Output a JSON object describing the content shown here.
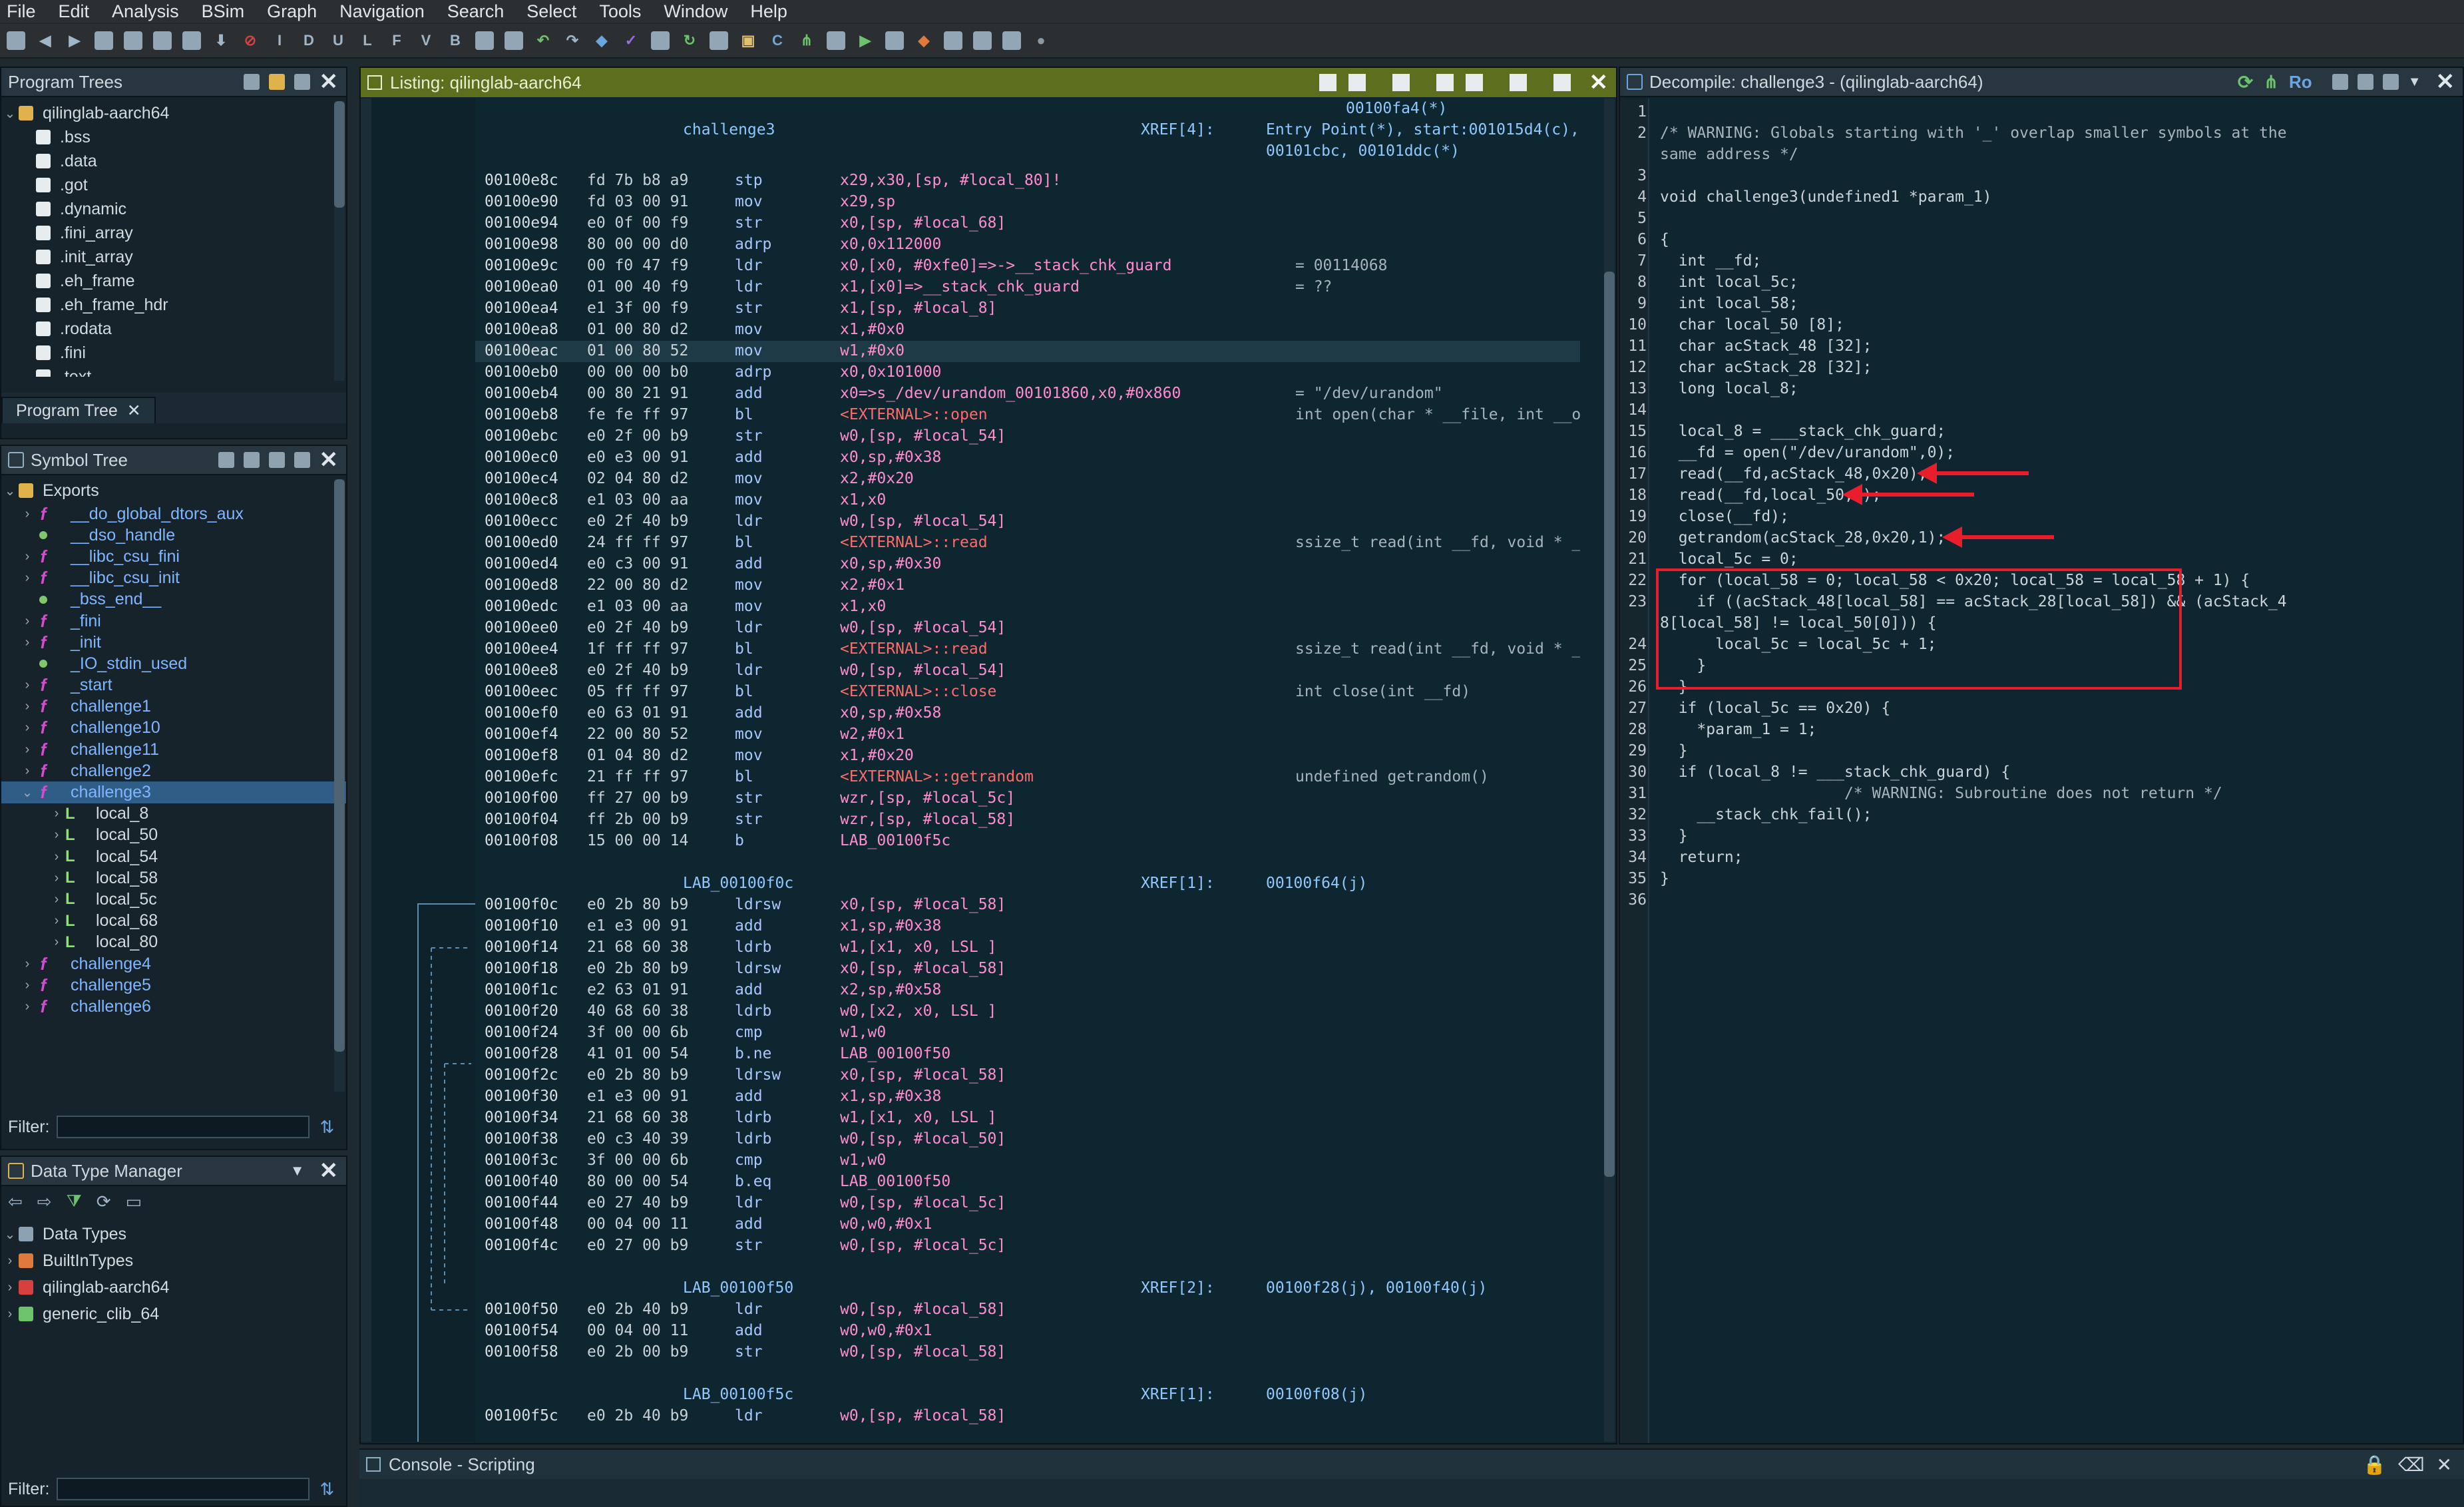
{
  "menu": [
    "File",
    "Edit",
    "Analysis",
    "BSim",
    "Graph",
    "Navigation",
    "Search",
    "Select",
    "Tools",
    "Window",
    "Help"
  ],
  "program_trees": {
    "title": "Program Trees",
    "root": "qilinglab-aarch64",
    "sections": [
      ".bss",
      ".data",
      ".got",
      ".dynamic",
      ".fini_array",
      ".init_array",
      ".eh_frame",
      ".eh_frame_hdr",
      ".rodata",
      ".fini",
      ".text"
    ],
    "tab": "Program Tree"
  },
  "symbol_tree": {
    "title": "Symbol Tree",
    "exports_label": "Exports",
    "items": [
      {
        "name": "__do_global_dtors_aux",
        "kind": "f"
      },
      {
        "name": "__dso_handle",
        "kind": "d"
      },
      {
        "name": "__libc_csu_fini",
        "kind": "f"
      },
      {
        "name": "__libc_csu_init",
        "kind": "f"
      },
      {
        "name": "_bss_end__",
        "kind": "d"
      },
      {
        "name": "_fini",
        "kind": "f"
      },
      {
        "name": "_init",
        "kind": "f"
      },
      {
        "name": "_IO_stdin_used",
        "kind": "d"
      },
      {
        "name": "_start",
        "kind": "f"
      },
      {
        "name": "challenge1",
        "kind": "f"
      },
      {
        "name": "challenge10",
        "kind": "f"
      },
      {
        "name": "challenge11",
        "kind": "f"
      },
      {
        "name": "challenge2",
        "kind": "f"
      },
      {
        "name": "challenge3",
        "kind": "f",
        "selected": true
      },
      {
        "name": "local_8",
        "kind": "l"
      },
      {
        "name": "local_50",
        "kind": "l"
      },
      {
        "name": "local_54",
        "kind": "l"
      },
      {
        "name": "local_58",
        "kind": "l"
      },
      {
        "name": "local_5c",
        "kind": "l"
      },
      {
        "name": "local_68",
        "kind": "l"
      },
      {
        "name": "local_80",
        "kind": "l"
      },
      {
        "name": "challenge4",
        "kind": "f"
      },
      {
        "name": "challenge5",
        "kind": "f"
      },
      {
        "name": "challenge6",
        "kind": "f"
      }
    ],
    "filter_label": "Filter:"
  },
  "data_type_manager": {
    "title": "Data Type Manager",
    "root": "Data Types",
    "items": [
      "BuiltInTypes",
      "qilinglab-aarch64",
      "generic_clib_64"
    ],
    "filter_label": "Filter:"
  },
  "listing": {
    "title": "Listing:  qilinglab-aarch64",
    "header": {
      "label": "challenge3",
      "xref": "XREF[4]:",
      "refs1": "00100fa4(*)",
      "refs2": "Entry Point(*), start:001015d4(c),",
      "refs3": "00101cbc, 00101ddc(*)"
    },
    "rows": [
      [
        "00100e8c",
        "fd 7b b8 a9",
        "stp",
        "x29,x30,[sp, #local_80]!",
        ""
      ],
      [
        "00100e90",
        "fd 03 00 91",
        "mov",
        "x29,sp",
        ""
      ],
      [
        "00100e94",
        "e0 0f 00 f9",
        "str",
        "x0,[sp, #local_68]",
        ""
      ],
      [
        "00100e98",
        "80 00 00 d0",
        "adrp",
        "x0,0x112000",
        ""
      ],
      [
        "00100e9c",
        "00 f0 47 f9",
        "ldr",
        "x0,[x0, #0xfe0]=>->__stack_chk_guard",
        "= 00114068"
      ],
      [
        "00100ea0",
        "01 00 40 f9",
        "ldr",
        "x1,[x0]=>__stack_chk_guard",
        "= ??"
      ],
      [
        "00100ea4",
        "e1 3f 00 f9",
        "str",
        "x1,[sp, #local_8]",
        ""
      ],
      [
        "00100ea8",
        "01 00 80 d2",
        "mov",
        "x1,#0x0",
        ""
      ],
      [
        "00100eac",
        "01 00 80 52",
        "mov",
        "w1,#0x0",
        ""
      ],
      [
        "00100eb0",
        "00 00 00 b0",
        "adrp",
        "x0,0x101000",
        ""
      ],
      [
        "00100eb4",
        "00 80 21 91",
        "add",
        "x0=>s_/dev/urandom_00101860,x0,#0x860",
        "= \"/dev/urandom\""
      ],
      [
        "00100eb8",
        "fe fe ff 97",
        "bl",
        "<EXTERNAL>::open",
        "int open(char * __file, int __oflag, ...)"
      ],
      [
        "00100ebc",
        "e0 2f 00 b9",
        "str",
        "w0,[sp, #local_54]",
        ""
      ],
      [
        "00100ec0",
        "e0 e3 00 91",
        "add",
        "x0,sp,#0x38",
        ""
      ],
      [
        "00100ec4",
        "02 04 80 d2",
        "mov",
        "x2,#0x20",
        ""
      ],
      [
        "00100ec8",
        "e1 03 00 aa",
        "mov",
        "x1,x0",
        ""
      ],
      [
        "00100ecc",
        "e0 2f 40 b9",
        "ldr",
        "w0,[sp, #local_54]",
        ""
      ],
      [
        "00100ed0",
        "24 ff ff 97",
        "bl",
        "<EXTERNAL>::read",
        "ssize_t read(int __fd, void * __buf, siz"
      ],
      [
        "00100ed4",
        "e0 c3 00 91",
        "add",
        "x0,sp,#0x30",
        ""
      ],
      [
        "00100ed8",
        "22 00 80 d2",
        "mov",
        "x2,#0x1",
        ""
      ],
      [
        "00100edc",
        "e1 03 00 aa",
        "mov",
        "x1,x0",
        ""
      ],
      [
        "00100ee0",
        "e0 2f 40 b9",
        "ldr",
        "w0,[sp, #local_54]",
        ""
      ],
      [
        "00100ee4",
        "1f ff ff 97",
        "bl",
        "<EXTERNAL>::read",
        "ssize_t read(int __fd, void * __buf, siz"
      ],
      [
        "00100ee8",
        "e0 2f 40 b9",
        "ldr",
        "w0,[sp, #local_54]",
        ""
      ],
      [
        "00100eec",
        "05 ff ff 97",
        "bl",
        "<EXTERNAL>::close",
        "int close(int __fd)"
      ],
      [
        "00100ef0",
        "e0 63 01 91",
        "add",
        "x0,sp,#0x58",
        ""
      ],
      [
        "00100ef4",
        "22 00 80 52",
        "mov",
        "w2,#0x1",
        ""
      ],
      [
        "00100ef8",
        "01 04 80 d2",
        "mov",
        "x1,#0x20",
        ""
      ],
      [
        "00100efc",
        "21 ff ff 97",
        "bl",
        "<EXTERNAL>::getrandom",
        "undefined getrandom()"
      ],
      [
        "00100f00",
        "ff 27 00 b9",
        "str",
        "wzr,[sp, #local_5c]",
        ""
      ],
      [
        "00100f04",
        "ff 2b 00 b9",
        "str",
        "wzr,[sp, #local_58]",
        ""
      ],
      [
        "00100f08",
        "15 00 00 14",
        "b",
        "LAB_00100f5c",
        ""
      ]
    ],
    "lab1": {
      "label": "LAB_00100f0c",
      "xref": "XREF[1]:",
      "ref": "00100f64(j)"
    },
    "rows2": [
      [
        "00100f0c",
        "e0 2b 80 b9",
        "ldrsw",
        "x0,[sp, #local_58]",
        ""
      ],
      [
        "00100f10",
        "e1 e3 00 91",
        "add",
        "x1,sp,#0x38",
        ""
      ],
      [
        "00100f14",
        "21 68 60 38",
        "ldrb",
        "w1,[x1, x0, LSL ]",
        ""
      ],
      [
        "00100f18",
        "e0 2b 80 b9",
        "ldrsw",
        "x0,[sp, #local_58]",
        ""
      ],
      [
        "00100f1c",
        "e2 63 01 91",
        "add",
        "x2,sp,#0x58",
        ""
      ],
      [
        "00100f20",
        "40 68 60 38",
        "ldrb",
        "w0,[x2, x0, LSL ]",
        ""
      ],
      [
        "00100f24",
        "3f 00 00 6b",
        "cmp",
        "w1,w0",
        ""
      ],
      [
        "00100f28",
        "41 01 00 54",
        "b.ne",
        "LAB_00100f50",
        ""
      ],
      [
        "00100f2c",
        "e0 2b 80 b9",
        "ldrsw",
        "x0,[sp, #local_58]",
        ""
      ],
      [
        "00100f30",
        "e1 e3 00 91",
        "add",
        "x1,sp,#0x38",
        ""
      ],
      [
        "00100f34",
        "21 68 60 38",
        "ldrb",
        "w1,[x1, x0, LSL ]",
        ""
      ],
      [
        "00100f38",
        "e0 c3 40 39",
        "ldrb",
        "w0,[sp, #local_50]",
        ""
      ],
      [
        "00100f3c",
        "3f 00 00 6b",
        "cmp",
        "w1,w0",
        ""
      ],
      [
        "00100f40",
        "80 00 00 54",
        "b.eq",
        "LAB_00100f50",
        ""
      ],
      [
        "00100f44",
        "e0 27 40 b9",
        "ldr",
        "w0,[sp, #local_5c]",
        ""
      ],
      [
        "00100f48",
        "00 04 00 11",
        "add",
        "w0,w0,#0x1",
        ""
      ],
      [
        "00100f4c",
        "e0 27 00 b9",
        "str",
        "w0,[sp, #local_5c]",
        ""
      ]
    ],
    "lab2": {
      "label": "LAB_00100f50",
      "xref": "XREF[2]:",
      "ref": "00100f28(j), 00100f40(j)"
    },
    "rows3": [
      [
        "00100f50",
        "e0 2b 40 b9",
        "ldr",
        "w0,[sp, #local_58]",
        ""
      ],
      [
        "00100f54",
        "00 04 00 11",
        "add",
        "w0,w0,#0x1",
        ""
      ],
      [
        "00100f58",
        "e0 2b 00 b9",
        "str",
        "w0,[sp, #local_58]",
        ""
      ]
    ],
    "lab3": {
      "label": "LAB_00100f5c",
      "xref": "XREF[1]:",
      "ref": "00100f08(j)"
    },
    "rows4": [
      [
        "00100f5c",
        "e0 2b 40 b9",
        "ldr",
        "w0,[sp, #local_58]",
        ""
      ]
    ]
  },
  "decompile": {
    "title": "Decompile: challenge3 -  (qilinglab-aarch64)",
    "lines": [
      "",
      "/* WARNING: Globals starting with '_' overlap smaller symbols at the",
      "same address */",
      "",
      "void challenge3(undefined1 *param_1)",
      "",
      "{",
      "  int __fd;",
      "  int local_5c;",
      "  int local_58;",
      "  char local_50 [8];",
      "  char acStack_48 [32];",
      "  char acStack_28 [32];",
      "  long local_8;",
      "",
      "  local_8 = ___stack_chk_guard;",
      "  __fd = open(\"/dev/urandom\",0);",
      "  read(__fd,acStack_48,0x20);",
      "  read(__fd,local_50,1);",
      "  close(__fd);",
      "  getrandom(acStack_28,0x20,1);",
      "  local_5c = 0;",
      "  for (local_58 = 0; local_58 < 0x20; local_58 = local_58 + 1) {",
      "    if ((acStack_48[local_58] == acStack_28[local_58]) && (acStack_4",
      "8[local_58] != local_50[0])) {",
      "      local_5c = local_5c + 1;",
      "    }",
      "  }",
      "  if (local_5c == 0x20) {",
      "    *param_1 = 1;",
      "  }",
      "  if (local_8 != ___stack_chk_guard) {",
      "                    /* WARNING: Subroutine does not return */",
      "    __stack_chk_fail();",
      "  }",
      "  return;",
      "}",
      ""
    ],
    "line_numbers": [
      "1",
      "2",
      "",
      "3",
      "4",
      "5",
      "6",
      "7",
      "8",
      "9",
      "10",
      "11",
      "12",
      "13",
      "14",
      "15",
      "16",
      "17",
      "18",
      "19",
      "20",
      "21",
      "22",
      "23",
      "",
      "24",
      "25",
      "26",
      "27",
      "28",
      "29",
      "30",
      "31",
      "32",
      "33",
      "34",
      "35",
      "36"
    ]
  },
  "console": {
    "title": "Console - Scripting"
  },
  "colors": {
    "highlight": "#e81e2c",
    "listing_title": "#5d6e1f"
  }
}
